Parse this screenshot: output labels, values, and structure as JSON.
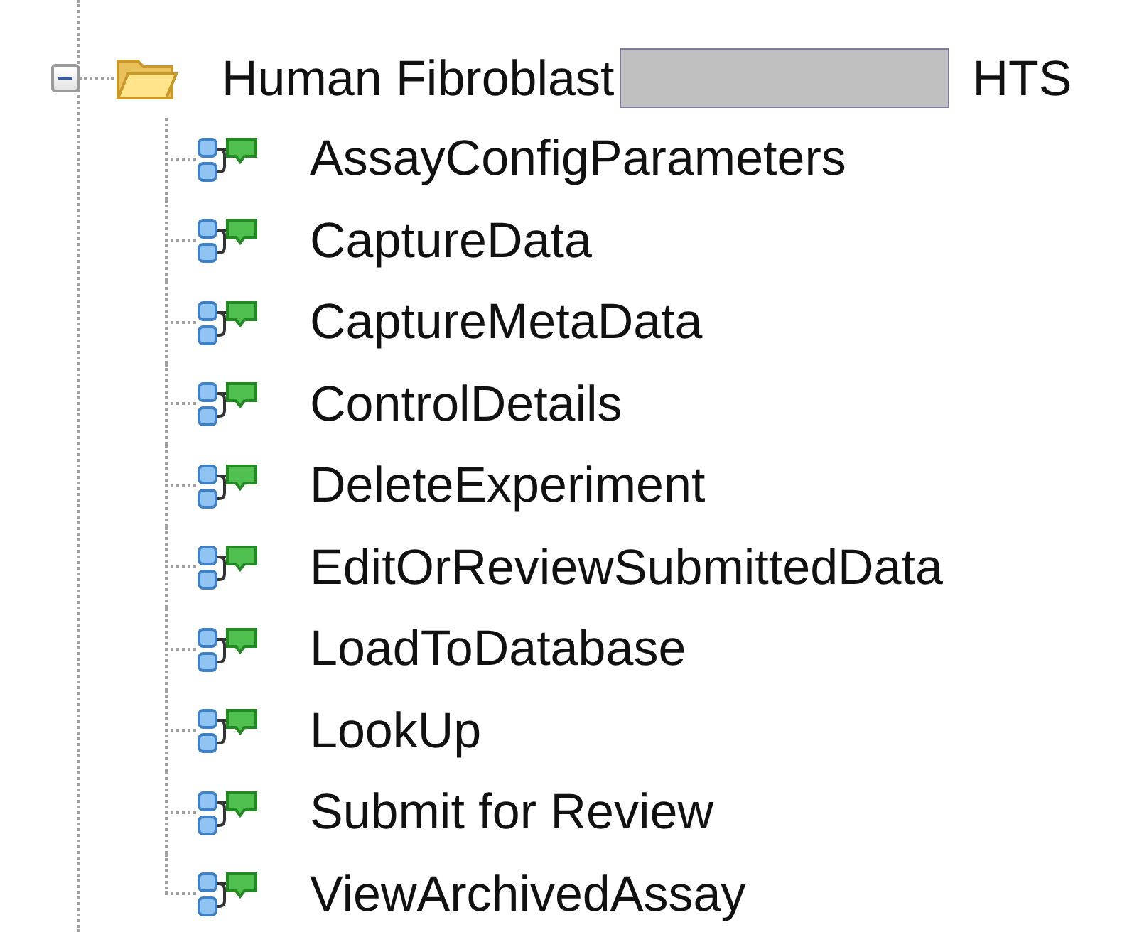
{
  "tree": {
    "root": {
      "label_start": "Human Fibroblast",
      "redacted": true,
      "label_end": "HTS",
      "expanded": true,
      "children": [
        {
          "label": "AssayConfigParameters"
        },
        {
          "label": "CaptureData"
        },
        {
          "label": "CaptureMetaData"
        },
        {
          "label": "ControlDetails"
        },
        {
          "label": "DeleteExperiment"
        },
        {
          "label": "EditOrReviewSubmittedData"
        },
        {
          "label": "LoadToDatabase"
        },
        {
          "label": "LookUp"
        },
        {
          "label": "Submit for Review"
        },
        {
          "label": "ViewArchivedAssay"
        }
      ]
    }
  }
}
